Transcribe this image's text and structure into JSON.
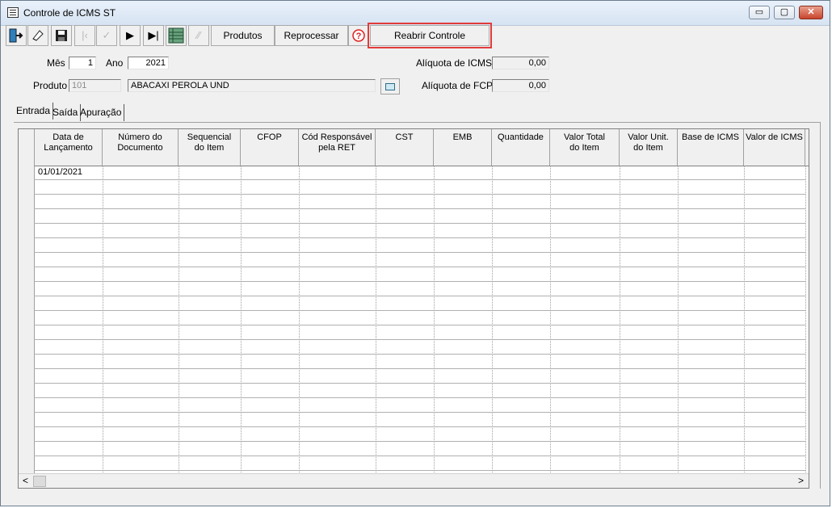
{
  "window": {
    "title": "Controle de ICMS ST",
    "min_label": "▭",
    "max_label": "▢",
    "close_label": "✕"
  },
  "toolbar": {
    "exit_icon": "exit-icon",
    "eraser_icon": "eraser-icon",
    "save_icon": "floppy-disk-icon",
    "first_icon": "first-record-icon",
    "confirm_icon": "check-icon",
    "next_icon": "next-record-icon",
    "last_icon": "last-record-icon",
    "grid_icon": "grid-icon",
    "disabled_icon": "bookmark-icon",
    "produtos_label": "Produtos",
    "reprocessar_label": "Reprocessar",
    "help_icon": "help-icon",
    "reabrir_label": "Reabrir Controle",
    "highlight_color": "#e23b3b"
  },
  "form": {
    "mes_label": "Mês",
    "mes_value": "1",
    "ano_label": "Ano",
    "ano_value": "2021",
    "produto_label": "Produto",
    "produto_code": "101",
    "produto_desc": "ABACAXI PEROLA UND",
    "aliquota_icms_label": "Alíquota de ICMS",
    "aliquota_icms_value": "0,00",
    "aliquota_fcp_label": "Alíquota de FCP",
    "aliquota_fcp_value": "0,00"
  },
  "tabs": [
    {
      "label": "Entrada",
      "active": true
    },
    {
      "label": "Saída",
      "active": false
    },
    {
      "label": "Apuração",
      "active": false
    }
  ],
  "grid": {
    "columns": [
      "Data de\nLançamento",
      "Número do\nDocumento",
      "Sequencial\ndo Item",
      "CFOP",
      "Cód Responsável\npela RET",
      "CST",
      "EMB",
      "Quantidade",
      "Valor Total\ndo Item",
      "Valor Unit.\ndo Item",
      "Base de ICMS",
      "Valor de ICMS"
    ],
    "rows": [
      [
        "01/01/2021",
        "",
        "",
        "",
        "",
        "",
        "",
        "",
        "",
        "",
        "",
        ""
      ]
    ],
    "scroll_left": "<",
    "scroll_right": ">"
  }
}
